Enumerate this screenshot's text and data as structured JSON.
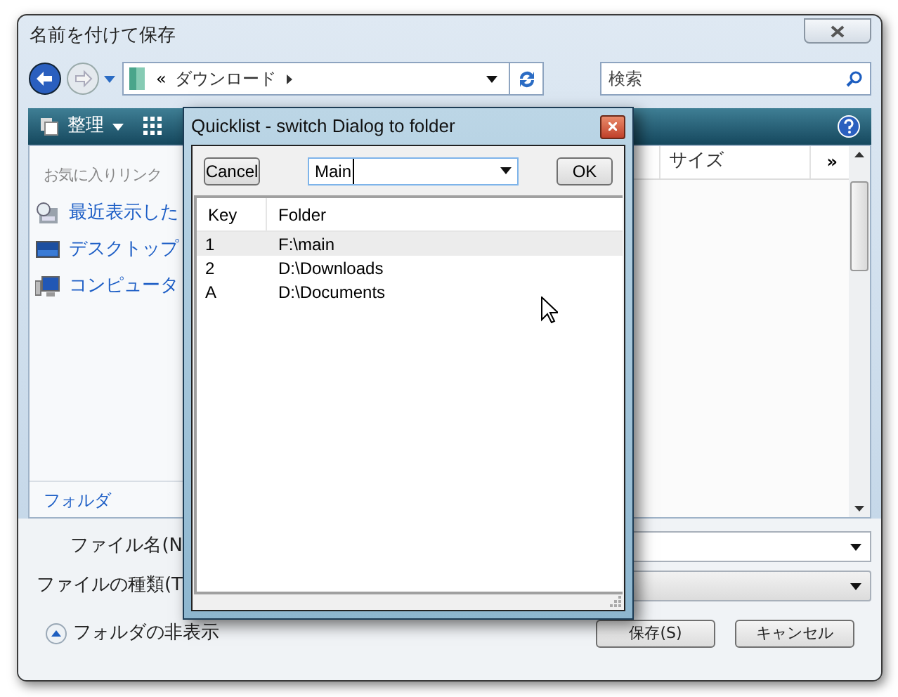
{
  "window": {
    "title": "名前を付けて保存"
  },
  "address": {
    "overflow": "«",
    "folder": "ダウンロード"
  },
  "search": {
    "placeholder": "検索"
  },
  "toolbar": {
    "organize": "整理"
  },
  "favorites": {
    "heading": "お気に入りリンク",
    "items": [
      {
        "label": "最近表示した",
        "kind": "recent"
      },
      {
        "label": "デスクトップ",
        "kind": "desktop"
      },
      {
        "label": "コンピュータ",
        "kind": "computer"
      }
    ]
  },
  "file_list": {
    "columns": [
      "サイズ",
      "»"
    ]
  },
  "folders_label": "フォルダ",
  "form": {
    "fields": [
      {
        "label": "ファイル名(N"
      },
      {
        "label": "ファイルの種類(T"
      }
    ]
  },
  "hide_folders": "フォルダの非表示",
  "buttons": [
    "保存(S)",
    "キャンセル"
  ],
  "quicklist": {
    "title": "Quicklist - switch Dialog to folder",
    "cancel": "Cancel",
    "combo_value": "Main",
    "ok": "OK",
    "columns": [
      "Key",
      "Folder"
    ],
    "rows": [
      {
        "key": "1",
        "folder": "F:\\main",
        "selected": true
      },
      {
        "key": "2",
        "folder": "D:\\Downloads",
        "selected": false
      },
      {
        "key": "A",
        "folder": "D:\\Documents",
        "selected": false
      }
    ]
  }
}
